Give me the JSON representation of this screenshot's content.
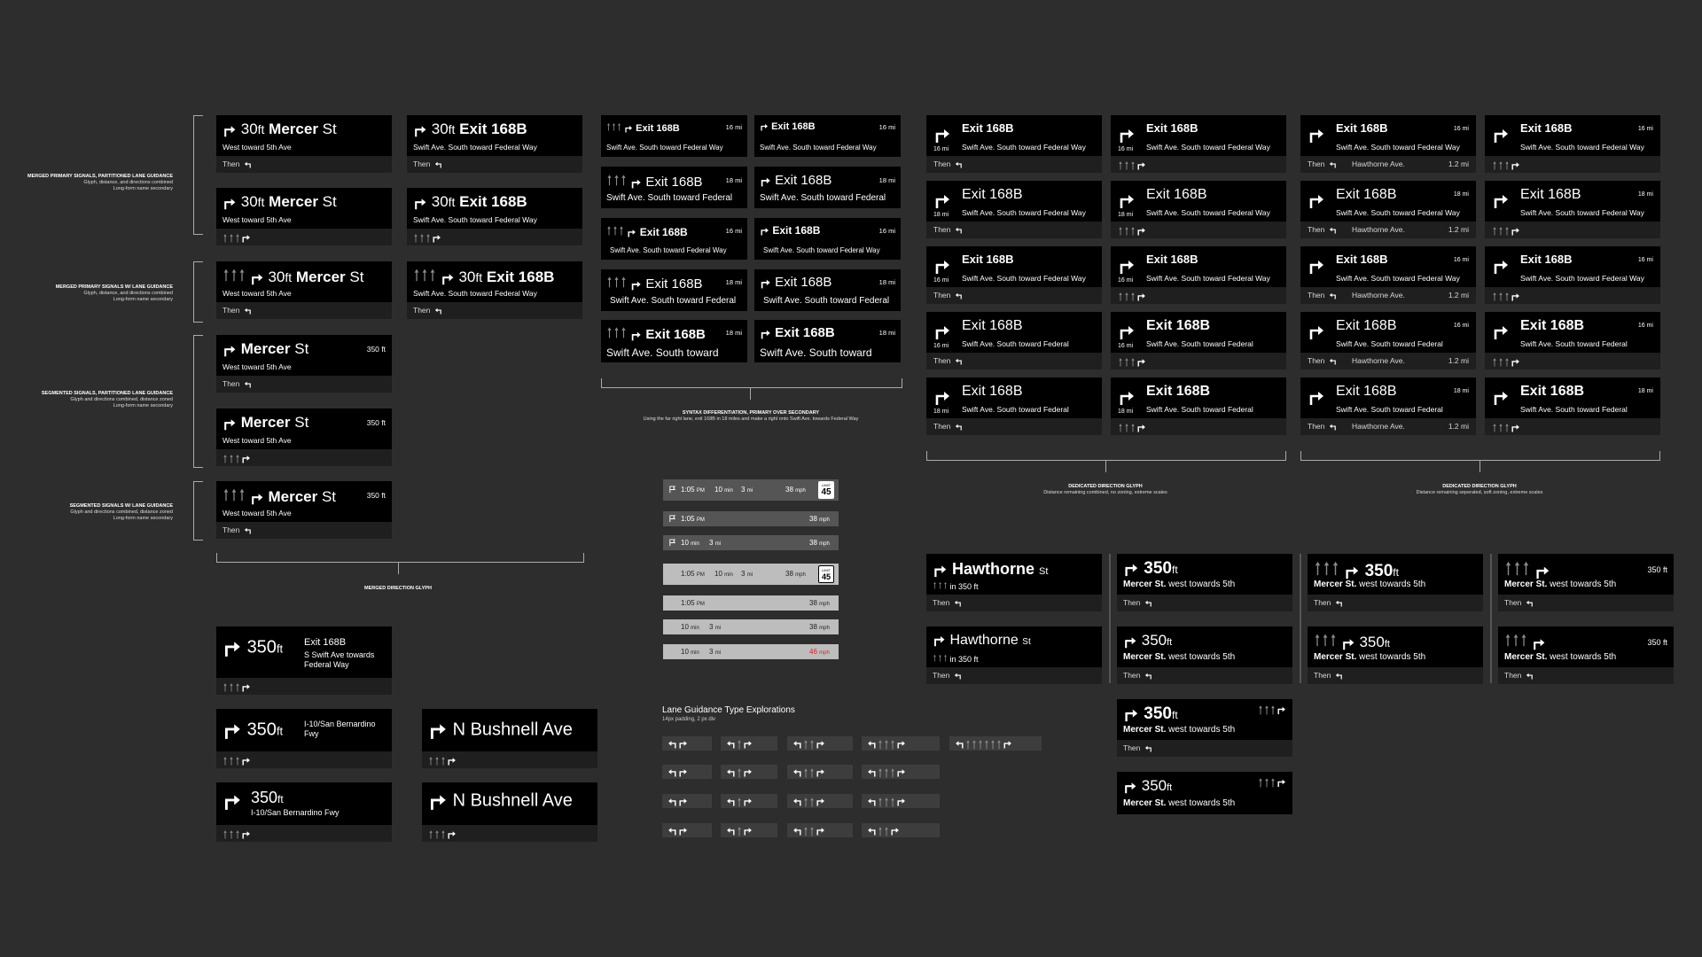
{
  "colors": {
    "background": "#2d2d2d",
    "card": "#000000",
    "strip": "#1f1f1f",
    "accent_red": "#e02020",
    "inactive_lane": "#8a8a8a"
  },
  "icons": [
    "turn-right-icon",
    "turn-left-icon",
    "straight-arrow-icon",
    "flag-icon",
    "speed-limit-icon"
  ],
  "annotations": {
    "a1": {
      "title": "MERGED PRIMARY SIGNALS, PARTITIONED LANE GUIDANCE",
      "l1": "Glyph, distance, and directions combined",
      "l2": "Long-form name secondary"
    },
    "a2": {
      "title": "MERGED PRIMARY SIGNALS W/ LANE GUIDANCE",
      "l1": "Glyph, distance, and directions combined",
      "l2": "Long-form name secondary"
    },
    "a3": {
      "title": "SEGMENTED SIGNALS, PARTITIONED LANE GUIDANCE",
      "l1": "Glyph and directions combined, distance zoned",
      "l2": "Long-form name secondary"
    },
    "a4": {
      "title": "SEGMENTED SIGNALS W/ LANE GUIDANCE",
      "l1": "Glyph and directions combined, distance zoned",
      "l2": "Long-form name secondary"
    }
  },
  "captions": {
    "merged": "MERGED DIRECTION GLYPH",
    "syntax_title": "SYNTAX DIFFERENTIATION, PRIMARY OVER SECONDARY",
    "syntax_sub": "Using the far right lane, exit 168B in 18 miles and make a right onto Swift Ave. towards Federal Way",
    "dedicated1_title": "DEDICATED DIRECTION GLYPH",
    "dedicated1_sub": "Distance remaining combined, no zoning, extreme scales",
    "dedicated2_title": "DEDICATED DIRECTION GLYPH",
    "dedicated2_sub": "Distance remaining seperated, soft zoning, extreme scales",
    "lane_title": "Lane Guidance Type Explorations",
    "lane_sub": "14px padding, 2 px div"
  },
  "common": {
    "then": "Then",
    "dist_30": "30",
    "unit_ft": "ft",
    "mercer": "Mercer",
    "st": "St",
    "exit": "Exit 168B",
    "west_5th": "West toward 5th Ave",
    "swift_federal_way": "Swift Ave. South toward Federal Way",
    "swift_federal": "Swift Ave. South toward Federal",
    "swift_toward": "Swift Ave. South toward",
    "mi16": "16 mi",
    "mi18": "18 mi",
    "ft350": "350 ft",
    "hawthorne_ave": "Hawthorne Ave.",
    "mi12": "1.2 mi"
  },
  "left_extra": {
    "c1": {
      "dist": "350",
      "unit": "ft",
      "exit": "Exit 168B",
      "sub": "S Swift Ave towards Federal Way"
    },
    "c2": {
      "dist": "350",
      "unit": "ft",
      "sub": "I-10/San Bernardino Fwy"
    },
    "c3": {
      "dist": "350",
      "unit": "ft",
      "sub": "I-10/San Bernardino Fwy"
    },
    "bushnell": "N Bushnell Ave"
  },
  "trip": {
    "time": "1:05",
    "pm": "PM",
    "mins": "10",
    "min_unit": "min",
    "miles": "3",
    "mi_unit": "mi",
    "speed": "38",
    "speed_red": "46",
    "mph": "mph",
    "limit_label": "LIMIT",
    "limit": "45"
  },
  "bottom_right": {
    "hawthorne": "Hawthorne",
    "hawthorne_st": "St",
    "in350": "in 350 ft",
    "dist": "350",
    "unit": "ft",
    "mercer_st": "Mercer St.",
    "west_5th": "west towards 5th",
    "ft350": "350 ft"
  }
}
